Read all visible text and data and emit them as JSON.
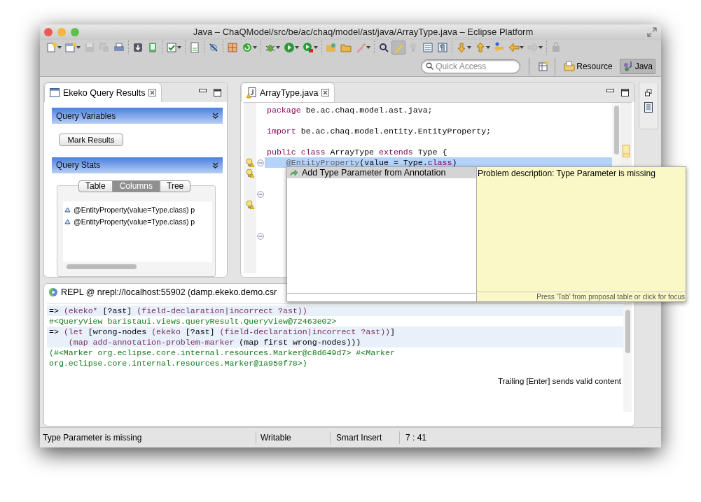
{
  "window": {
    "title": "Java – ChaQModel/src/be/ac/chaq/model/ast/java/ArrayType.java – Eclipse Platform"
  },
  "toolbar": [
    [
      {
        "dropdown": true,
        "disabled": false,
        "pressed": false
      },
      {
        "dropdown": true,
        "disabled": false,
        "pressed": false
      },
      {
        "dropdown": false,
        "disabled": true,
        "pressed": false
      },
      {
        "dropdown": false,
        "disabled": true,
        "pressed": false
      },
      {
        "dropdown": false,
        "disabled": false,
        "pressed": false
      }
    ],
    [
      {
        "dropdown": false,
        "disabled": false,
        "pressed": false
      },
      {
        "dropdown": false,
        "disabled": false,
        "pressed": false
      }
    ],
    [
      {
        "dropdown": true,
        "disabled": false,
        "pressed": false
      }
    ],
    [
      {
        "dropdown": false,
        "disabled": false,
        "pressed": false
      }
    ],
    [
      {
        "dropdown": false,
        "disabled": false,
        "pressed": false
      }
    ],
    [
      {
        "dropdown": false,
        "disabled": false,
        "pressed": false
      },
      {
        "dropdown": true,
        "disabled": false,
        "pressed": false
      }
    ],
    [
      {
        "dropdown": true,
        "disabled": false,
        "pressed": false
      },
      {
        "dropdown": true,
        "disabled": false,
        "pressed": false
      },
      {
        "dropdown": true,
        "disabled": false,
        "pressed": false
      }
    ],
    [
      {
        "dropdown": false,
        "disabled": false,
        "pressed": false
      },
      {
        "dropdown": false,
        "disabled": false,
        "pressed": false
      },
      {
        "dropdown": true,
        "disabled": false,
        "pressed": false
      }
    ],
    [
      {
        "dropdown": false,
        "disabled": false,
        "pressed": false
      },
      {
        "dropdown": false,
        "disabled": false,
        "pressed": true
      },
      {
        "dropdown": false,
        "disabled": true,
        "pressed": false
      },
      {
        "dropdown": false,
        "disabled": false,
        "pressed": false
      },
      {
        "dropdown": false,
        "disabled": false,
        "pressed": false
      }
    ],
    [
      {
        "dropdown": true,
        "disabled": false,
        "pressed": false
      },
      {
        "dropdown": true,
        "disabled": false,
        "pressed": false
      },
      {
        "dropdown": false,
        "disabled": false,
        "pressed": false
      },
      {
        "dropdown": true,
        "disabled": false,
        "pressed": false
      },
      {
        "dropdown": true,
        "disabled": true,
        "pressed": false
      }
    ],
    [
      {
        "dropdown": false,
        "disabled": true,
        "pressed": false
      }
    ]
  ],
  "quick_access": {
    "placeholder": "Quick Access"
  },
  "perspectives": [
    {
      "label": "Resource",
      "selected": false
    },
    {
      "label": "Java",
      "selected": true
    }
  ],
  "query_results_view": {
    "title": "Ekeko Query Results",
    "query_variables": {
      "title": "Query Variables",
      "button": "Mark Results"
    },
    "query_stats": {
      "title": "Query Stats",
      "tabs": [
        {
          "label": "Table",
          "selected": false
        },
        {
          "label": "Columns",
          "selected": true
        },
        {
          "label": "Tree",
          "selected": false
        }
      ],
      "rows": [
        "@EntityProperty(value=Type.class) p",
        "@EntityProperty(value=Type.class) p"
      ]
    }
  },
  "editor": {
    "tab": "ArrayType.java",
    "lines": [
      {
        "tokens": [
          {
            "text": "package",
            "kind": "keyword"
          },
          {
            "text": " be.ac.chaq.model.ast.java;",
            "kind": "plain"
          }
        ],
        "selected": false,
        "warning": false,
        "foldable": false
      },
      {
        "selected": false,
        "warning": false,
        "foldable": false
      },
      {
        "tokens": [
          {
            "text": "import",
            "kind": "keyword"
          },
          {
            "text": " be.ac.chaq.model.entity.EntityProperty;",
            "kind": "plain"
          }
        ],
        "selected": false,
        "warning": false,
        "foldable": false
      },
      {
        "selected": false,
        "warning": false,
        "foldable": false
      },
      {
        "tokens": [
          {
            "text": "public",
            "kind": "keyword"
          },
          {
            "text": " class",
            "kind": "keyword"
          },
          {
            "text": " ArrayType ",
            "kind": "plain"
          },
          {
            "text": "extends",
            "kind": "keyword"
          },
          {
            "text": " Type {",
            "kind": "plain"
          }
        ],
        "selected": false,
        "warning": false,
        "foldable": false
      },
      {
        "tokens": [
          {
            "text": "    @EntityProperty",
            "kind": "annotation"
          },
          {
            "text": "(value = Type.",
            "kind": "plain"
          },
          {
            "text": "class",
            "kind": "keyword"
          },
          {
            "text": ")",
            "kind": "plain"
          }
        ],
        "selected": true,
        "warning": true,
        "foldable": true
      },
      {
        "selected": false,
        "warning": true,
        "foldable": false
      },
      {
        "selected": false,
        "warning": false,
        "foldable": false
      },
      {
        "selected": false,
        "warning": false,
        "foldable": true
      },
      {
        "selected": false,
        "warning": true,
        "foldable": false
      },
      {
        "selected": false,
        "warning": false,
        "foldable": false
      },
      {
        "selected": false,
        "warning": false,
        "foldable": false
      },
      {
        "selected": false,
        "warning": false,
        "foldable": true
      }
    ]
  },
  "repl": {
    "title": "REPL @ nrepl://localhost:55902 (damp.ekeko.demo.csr",
    "lines": [
      {
        "kind": "input",
        "tokens": [
          {
            "text": "=> ",
            "kind": "plain"
          },
          {
            "text": "(ekeko*",
            "kind": "form"
          },
          {
            "text": " [?ast] ",
            "kind": "plain"
          },
          {
            "text": "(field-declaration|incorrect ?ast))",
            "kind": "form"
          }
        ]
      },
      {
        "kind": "output",
        "tokens": [
          {
            "text": "#<QueryView baristaui.views.queryResult.QueryView@72463e02>",
            "kind": "output"
          }
        ]
      },
      {
        "kind": "input",
        "tokens": [
          {
            "text": "=> ",
            "kind": "plain"
          },
          {
            "text": "(let",
            "kind": "form"
          },
          {
            "text": " [wrong-nodes ",
            "kind": "plain"
          },
          {
            "text": "(ekeko",
            "kind": "form"
          },
          {
            "text": " [?ast] ",
            "kind": "plain"
          },
          {
            "text": "(field-declaration|incorrect ?ast))",
            "kind": "form"
          },
          {
            "text": "]",
            "kind": "plain"
          }
        ]
      },
      {
        "kind": "input",
        "tokens": [
          {
            "text": "    (map add-annotation-problem-marker",
            "kind": "form"
          },
          {
            "text": " (map first wrong-nodes)))",
            "kind": "plain"
          }
        ]
      },
      {
        "kind": "output",
        "tokens": [
          {
            "text": "(#<Marker org.eclipse.core.internal.resources.Marker@c8d649d7> #<Marker",
            "kind": "output"
          }
        ]
      },
      {
        "kind": "output",
        "tokens": [
          {
            "text": "org.eclipse.core.internal.resources.Marker@1a950f78>)",
            "kind": "output"
          }
        ]
      }
    ],
    "hint": "Trailing [Enter] sends valid content"
  },
  "proposals": {
    "items": [
      {
        "label": "Add Type Parameter from Annotation",
        "selected": true
      }
    ],
    "description": "Problem description: Type Parameter is missing",
    "footer": "Press 'Tab' from proposal table or click for focus"
  },
  "status_bar": [
    "Type Parameter is missing",
    "Writable",
    "Smart Insert",
    "7 : 41"
  ]
}
